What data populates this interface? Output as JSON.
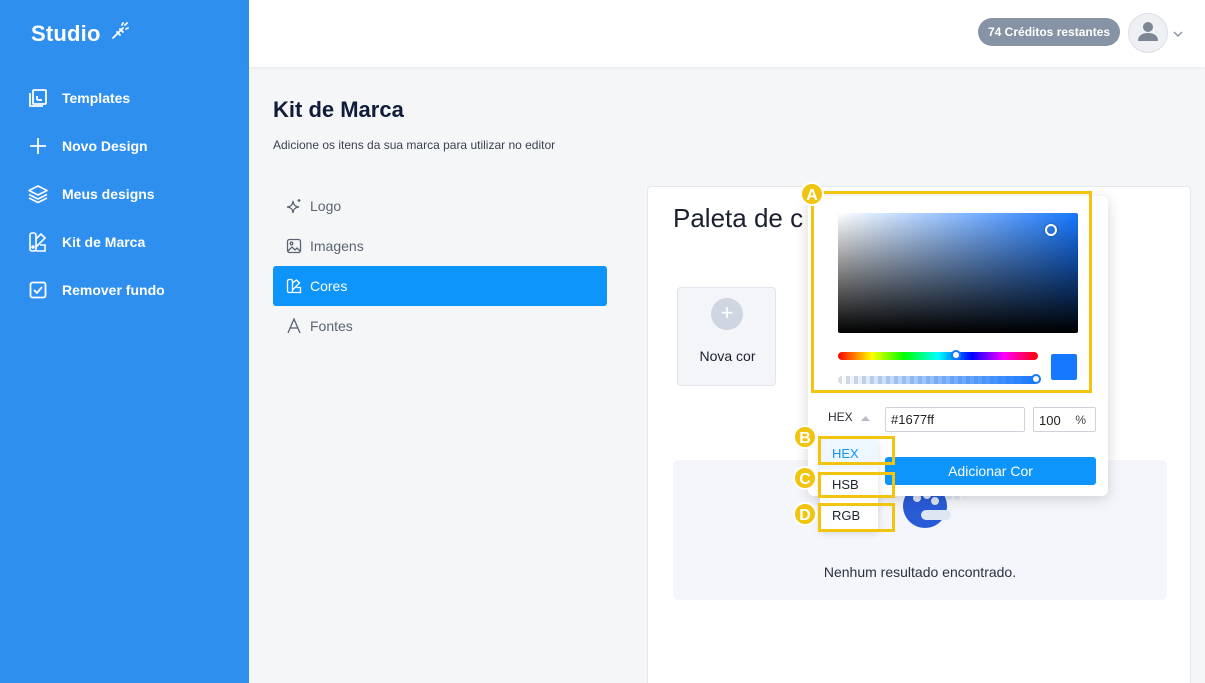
{
  "brand": {
    "name": "Studio"
  },
  "sidebar": {
    "items": [
      {
        "label": "Templates",
        "icon": "templates-icon"
      },
      {
        "label": "Novo Design",
        "icon": "plus-icon"
      },
      {
        "label": "Meus designs",
        "icon": "layers-icon"
      },
      {
        "label": "Kit de Marca",
        "icon": "brand-kit-icon"
      },
      {
        "label": "Remover fundo",
        "icon": "checkbox-icon"
      }
    ]
  },
  "topbar": {
    "credits": "74 Créditos restantes"
  },
  "page": {
    "title": "Kit de Marca",
    "subtitle": "Adicione os itens da sua marca para utilizar no editor"
  },
  "subnav": {
    "items": [
      {
        "label": "Logo",
        "icon": "sparkle-icon",
        "active": false
      },
      {
        "label": "Imagens",
        "icon": "image-icon",
        "active": false
      },
      {
        "label": "Cores",
        "icon": "palette-icon",
        "active": true
      },
      {
        "label": "Fontes",
        "icon": "font-icon",
        "active": false
      }
    ]
  },
  "panel": {
    "title": "Paleta de c",
    "new_color_label": "Nova cor",
    "empty_text": "Nenhum resultado encontrado."
  },
  "picker": {
    "current_color": "#1677ff",
    "format": "HEX",
    "hex_value": "#1677ff",
    "alpha_value": "100",
    "alpha_unit": "%",
    "add_button": "Adicionar Cor",
    "format_options": [
      "HEX",
      "HSB",
      "RGB"
    ]
  },
  "annotations": {
    "a": "A",
    "b": "B",
    "c": "C",
    "d": "D"
  },
  "colors": {
    "sidebar": "#2f8fef",
    "accent": "#0e95fb",
    "highlight": "#f1c40f"
  }
}
